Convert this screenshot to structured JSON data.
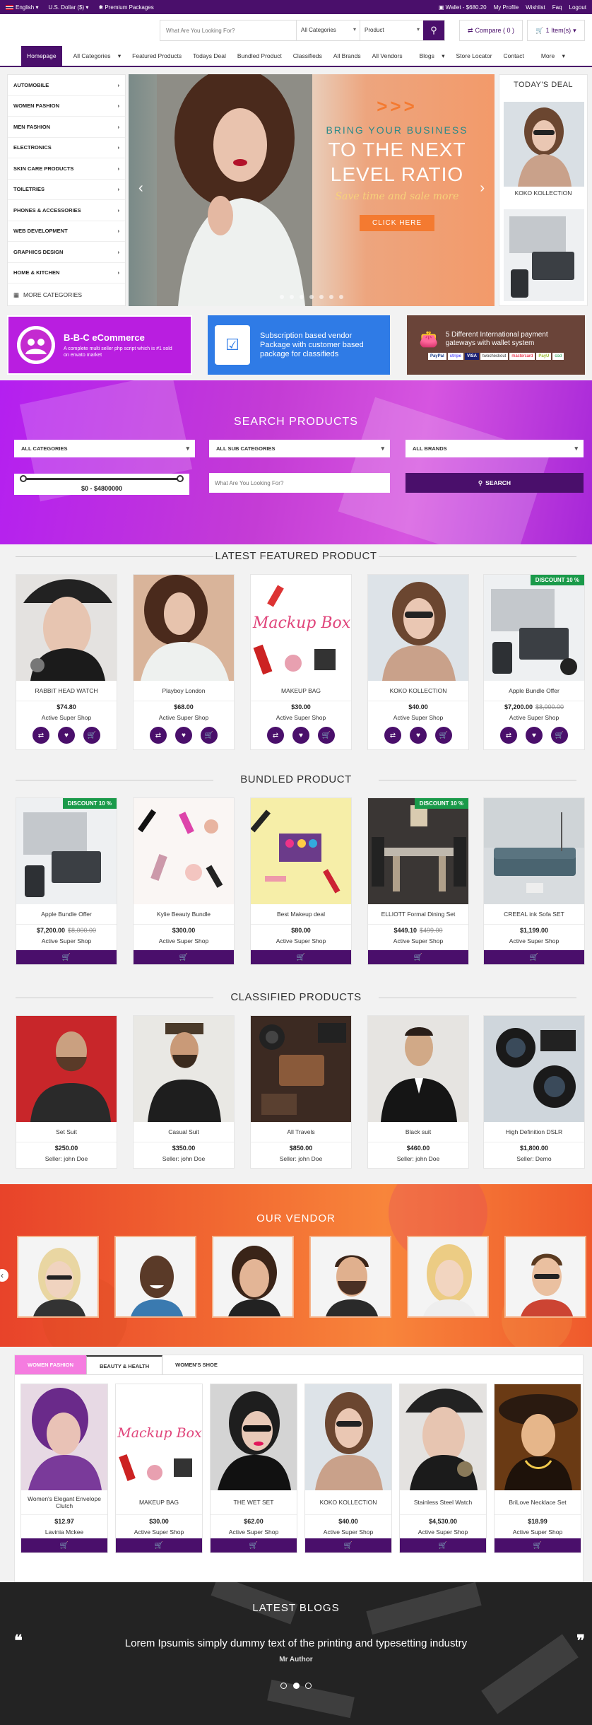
{
  "topbar": {
    "language": "English",
    "currency": "U.S. Dollar ($)",
    "premium": "Premium Packages",
    "wallet": "Wallet - $680.20",
    "links": [
      "My Profile",
      "Wishlist",
      "Faq",
      "Logout"
    ]
  },
  "header": {
    "search_placeholder": "What Are You Looking For?",
    "category_select": "All Categories",
    "type_select": "Product",
    "compare": "Compare ( 0 )",
    "cart": "1 Item(s)"
  },
  "nav": [
    "Homepage",
    "All Categories",
    "Featured Products",
    "Todays Deal",
    "Bundled Product",
    "Classifieds",
    "All Brands",
    "All Vendors",
    "Blogs",
    "Store Locator",
    "Contact",
    "More"
  ],
  "categories": [
    "AUTOMOBILE",
    "WOMEN FASHION",
    "MEN FASHION",
    "ELECTRONICS",
    "SKIN CARE PRODUCTS",
    "TOILETRIES",
    "PHONES & ACCESSORIES",
    "WEB DEVELOPMENT",
    "GRAPHICS DESIGN",
    "HOME & KITCHEN"
  ],
  "more_categories": "MORE CATEGORIES",
  "hero": {
    "chevrons": ">>>",
    "line1": "BRING YOUR BUSINESS",
    "line2": "TO THE NEXT",
    "line3": "LEVEL RATIO",
    "tagline": "Save time and sale more",
    "cta": "CLICK HERE"
  },
  "todays_deal": {
    "title": "TODAY'S DEAL",
    "item": "KOKO KOLLECTION"
  },
  "banners": {
    "b1_title": "B-B-C eCommerce",
    "b1_sub": "A complete multi seller php script which is #1 sold on envato market",
    "b2_text": "Subscription based vendor Package with customer based package for classifieds",
    "b3_text": "5 Different International payment gateways with wallet system",
    "payments": [
      "PayPal",
      "stripe",
      "VISA",
      "twocheckout",
      "mastercard",
      "PayU",
      "cod"
    ]
  },
  "search_products": {
    "title": "SEARCH PRODUCTS",
    "all_categories": "ALL CATEGORIES",
    "all_sub_categories": "ALL SUB CATEGORIES",
    "all_brands": "ALL BRANDS",
    "price_range": "$0 - $4800000",
    "input_placeholder": "What Are You Looking For?",
    "button": "SEARCH"
  },
  "featured": {
    "title": "LATEST FEATURED PRODUCT",
    "items": [
      {
        "name": "RABBIT HEAD WATCH",
        "price": "$74.80",
        "old": "",
        "shop": "Active Super Shop",
        "discount": ""
      },
      {
        "name": "Playboy London",
        "price": "$68.00",
        "old": "",
        "shop": "Active Super Shop",
        "discount": ""
      },
      {
        "name": "MAKEUP BAG",
        "price": "$30.00",
        "old": "",
        "shop": "Active Super Shop",
        "discount": ""
      },
      {
        "name": "KOKO KOLLECTION",
        "price": "$40.00",
        "old": "",
        "shop": "Active Super Shop",
        "discount": ""
      },
      {
        "name": "Apple Bundle Offer",
        "price": "$7,200.00",
        "old": "$8,000.00",
        "shop": "Active Super Shop",
        "discount": "DISCOUNT 10 %"
      }
    ]
  },
  "bundled": {
    "title": "BUNDLED PRODUCT",
    "items": [
      {
        "name": "Apple Bundle Offer",
        "price": "$7,200.00",
        "old": "$8,000.00",
        "shop": "Active Super Shop",
        "discount": "DISCOUNT 10 %"
      },
      {
        "name": "Kylie Beauty Bundle",
        "price": "$300.00",
        "old": "",
        "shop": "Active Super Shop",
        "discount": ""
      },
      {
        "name": "Best Makeup deal",
        "price": "$80.00",
        "old": "",
        "shop": "Active Super Shop",
        "discount": ""
      },
      {
        "name": "ELLIOTT Formal Dining Set",
        "price": "$449.10",
        "old": "$499.00",
        "shop": "Active Super Shop",
        "discount": "DISCOUNT 10 %"
      },
      {
        "name": "CREEAL ink Sofa SET",
        "price": "$1,199.00",
        "old": "",
        "shop": "Active Super Shop",
        "discount": ""
      }
    ]
  },
  "classified": {
    "title": "CLASSIFIED PRODUCTS",
    "items": [
      {
        "name": "Set Suit",
        "price": "$250.00",
        "seller": "Seller: john Doe"
      },
      {
        "name": "Casual Suit",
        "price": "$350.00",
        "seller": "Seller: john Doe"
      },
      {
        "name": "All Travels",
        "price": "$850.00",
        "seller": "Seller: john Doe"
      },
      {
        "name": "Black suit",
        "price": "$460.00",
        "seller": "Seller: john Doe"
      },
      {
        "name": "High Definition DSLR",
        "price": "$1,800.00",
        "seller": "Seller: Demo"
      }
    ]
  },
  "vendor": {
    "title": "OUR VENDOR"
  },
  "tabs": {
    "labels": [
      "WOMEN FASHION",
      "BEAUTY & HEALTH",
      "WOMEN'S SHOE"
    ],
    "items": [
      {
        "name": "Women's Elegant Envelope Clutch",
        "price": "$12.97",
        "shop": "Lavinia Mckee"
      },
      {
        "name": "MAKEUP BAG",
        "price": "$30.00",
        "shop": "Active Super Shop"
      },
      {
        "name": "THE WET SET",
        "price": "$62.00",
        "shop": "Active Super Shop"
      },
      {
        "name": "KOKO KOLLECTION",
        "price": "$40.00",
        "shop": "Active Super Shop"
      },
      {
        "name": "Stainless Steel Watch",
        "price": "$4,530.00",
        "shop": "Active Super Shop"
      },
      {
        "name": "BriLove Necklace Set",
        "price": "$18.99",
        "shop": "Active Super Shop"
      }
    ]
  },
  "blogs": {
    "title": "LATEST BLOGS",
    "quote": "Lorem Ipsumis simply dummy text of the printing and typesetting industry",
    "author": "Mr Author"
  },
  "colors": {
    "brand": "#4a0f6b",
    "accent": "#b41ff0",
    "discount": "#1a9a4a",
    "vendor": "#f26b32"
  }
}
